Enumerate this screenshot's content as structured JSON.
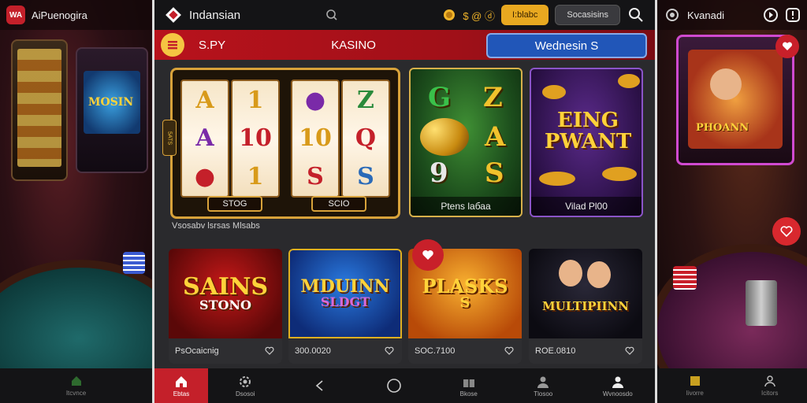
{
  "left_panel": {
    "app_title": "AiPuenogira",
    "logo_text": "WA",
    "nav": [
      {
        "label": "Itcvnce",
        "icon": "home-icon"
      }
    ]
  },
  "right_panel": {
    "app_title": "Kvanadi",
    "nav": [
      {
        "label": "Iivorre",
        "icon": "grid-icon"
      },
      {
        "label": "Icitors",
        "icon": "user-icon"
      }
    ]
  },
  "header": {
    "app_name": "Indansian",
    "coin_label": "$ @ ⓓ",
    "gold_button": "I:blabc",
    "dark_button": "Socasisins"
  },
  "tabs": {
    "items": [
      "S.PY",
      "KASINO"
    ],
    "active": "Wednesin S"
  },
  "featured": {
    "side_tag": "5ATS",
    "slot_labels": [
      "STOG",
      "SCIO"
    ],
    "green_card_caption": "Ptens lабаа",
    "green_letters": [
      "G",
      "Z",
      "A",
      "9",
      "S"
    ],
    "purple_card_title": "EING PWANT",
    "purple_card_caption": "Vilad Pl00",
    "note": "Vsosabv lsrsas Mlsabs"
  },
  "games": [
    {
      "title": "SAINS",
      "subtitle": "STONO",
      "meta": "PsOcaicnig",
      "bg": "#7a0e0e"
    },
    {
      "title": "MDUINN",
      "subtitle": "SLDGT",
      "meta": "300.0020",
      "bg": "#1d4fb2"
    },
    {
      "title": "PLASKS",
      "subtitle": "S",
      "meta": "SOC.7100",
      "bg": "#d77a12"
    },
    {
      "title": "MULTIPIINN",
      "subtitle": "",
      "meta": "ROE.0810",
      "bg": "#15131c"
    }
  ],
  "bottom_nav": [
    {
      "label": "Ebtas",
      "icon": "home-icon"
    },
    {
      "label": "Dsosoi",
      "icon": "settings-icon"
    },
    {
      "label": "",
      "icon": "back-icon"
    },
    {
      "label": "",
      "icon": "circle-home-icon"
    },
    {
      "label": "Bkose",
      "icon": "gift-icon"
    },
    {
      "label": "Tlosoo",
      "icon": "user-icon"
    },
    {
      "label": "Wvnoosdo",
      "icon": "profile-icon"
    }
  ],
  "colors": {
    "accent_red": "#c4202a",
    "accent_gold": "#e8a820",
    "active_tab_blue": "#2156b8"
  }
}
